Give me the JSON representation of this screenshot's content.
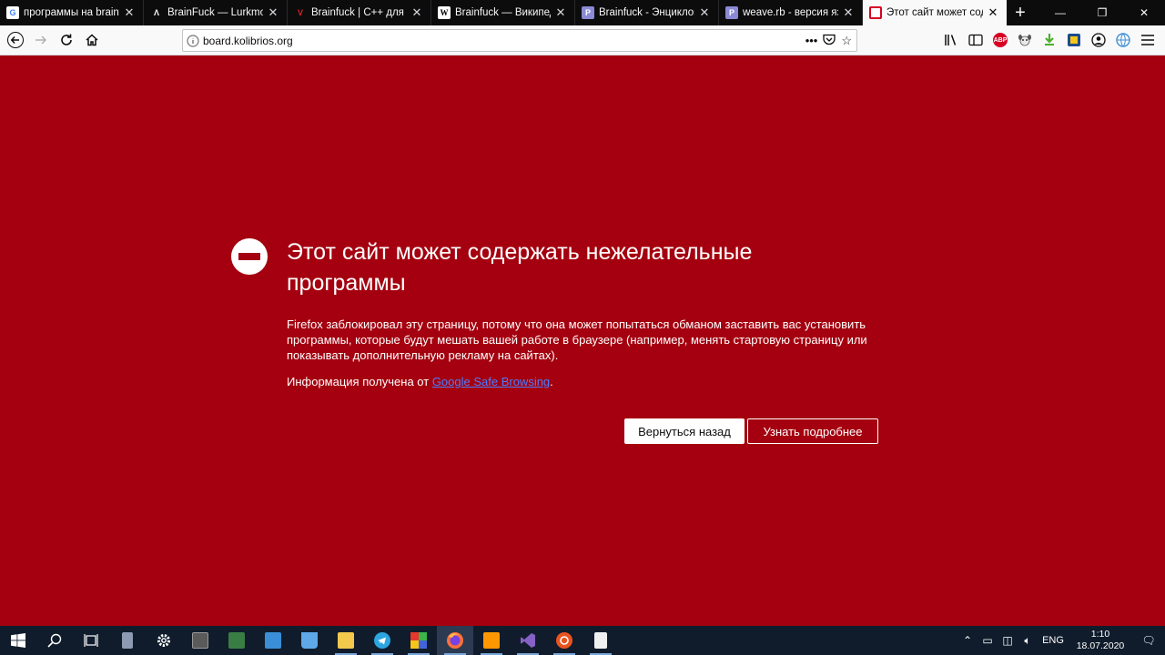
{
  "tabs": [
    {
      "label": "программы на brainfuck",
      "icon": "google-icon",
      "glyph": "G"
    },
    {
      "label": "BrainFuck — Lurkmore",
      "icon": "lurkmore-icon",
      "glyph": "Λ"
    },
    {
      "label": "Brainfuck | C++ для при",
      "icon": "cpp-icon",
      "glyph": "V"
    },
    {
      "label": "Brainfuck — Википедия",
      "icon": "wikipedia-icon",
      "glyph": "W"
    },
    {
      "label": "Brainfuck - Энциклопед",
      "icon": "encyclopedia-icon",
      "glyph": "P"
    },
    {
      "label": "weave.rb - версия язык",
      "icon": "page-icon",
      "glyph": "P"
    },
    {
      "label": "Этот сайт может содер",
      "icon": "warning-icon",
      "glyph": ""
    }
  ],
  "url": {
    "value": "board.kolibrios.org"
  },
  "error": {
    "title": "Этот сайт может содержать нежелательные программы",
    "description": "Firefox заблокировал эту страницу, потому что она может попытаться обманом заставить вас установить программы, которые будут мешать вашей работе в браузере (например, менять стартовую страницу или показывать дополнительную рекламу на сайтах).",
    "info_prefix": "Информация получена от ",
    "info_link": "Google Safe Browsing",
    "info_suffix": ".",
    "back_button": "Вернуться назад",
    "learn_more_button": "Узнать подробнее"
  },
  "toolbar_extras": {
    "abp": "ABP"
  },
  "taskbar": {
    "lang": "ENG",
    "time": "1:10",
    "date": "18.07.2020"
  },
  "colors": {
    "page_background": "#a4000f",
    "tabstrip": "#0c0c0d",
    "taskbar": "#101c2c",
    "link": "#4b7dff"
  }
}
